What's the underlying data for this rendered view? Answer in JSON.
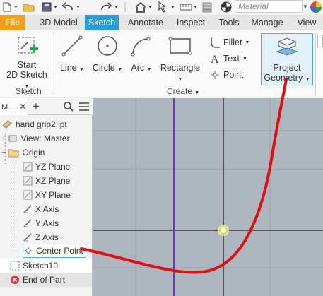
{
  "quick_access": {
    "material_placeholder": "Material"
  },
  "tabs": [
    {
      "label": "File"
    },
    {
      "label": "3D Model"
    },
    {
      "label": "Sketch"
    },
    {
      "label": "Annotate"
    },
    {
      "label": "Inspect"
    },
    {
      "label": "Tools"
    },
    {
      "label": "Manage"
    },
    {
      "label": "View"
    }
  ],
  "ribbon": {
    "start_sketch_line1": "Start",
    "start_sketch_line2": "2D Sketch",
    "line": "Line",
    "circle": "Circle",
    "arc": "Arc",
    "rectangle": "Rectangle",
    "fillet": "Fillet",
    "text": "Text",
    "point": "Point",
    "project_line1": "Project",
    "project_line2": "Geometry",
    "panel_sketch": "Sketch",
    "panel_create": "Create"
  },
  "browser": {
    "tab_label": "M...",
    "items": [
      {
        "label": "hand grip2.ipt"
      },
      {
        "label": "View: Master"
      },
      {
        "label": "Origin"
      },
      {
        "label": "YZ Plane"
      },
      {
        "label": "XZ Plane"
      },
      {
        "label": "XY Plane"
      },
      {
        "label": "X Axis"
      },
      {
        "label": "Y Axis"
      },
      {
        "label": "Z Axis"
      },
      {
        "label": "Center Point"
      },
      {
        "label": "Sketch10"
      },
      {
        "label": "End of Part"
      }
    ]
  },
  "colors": {
    "file_tab": "#f29d1d",
    "active_tab": "#2a9bd6",
    "viewport_bg": "#aeb6bf",
    "y_axis_line": "#7a2fd0",
    "annotation": "#e01010"
  }
}
